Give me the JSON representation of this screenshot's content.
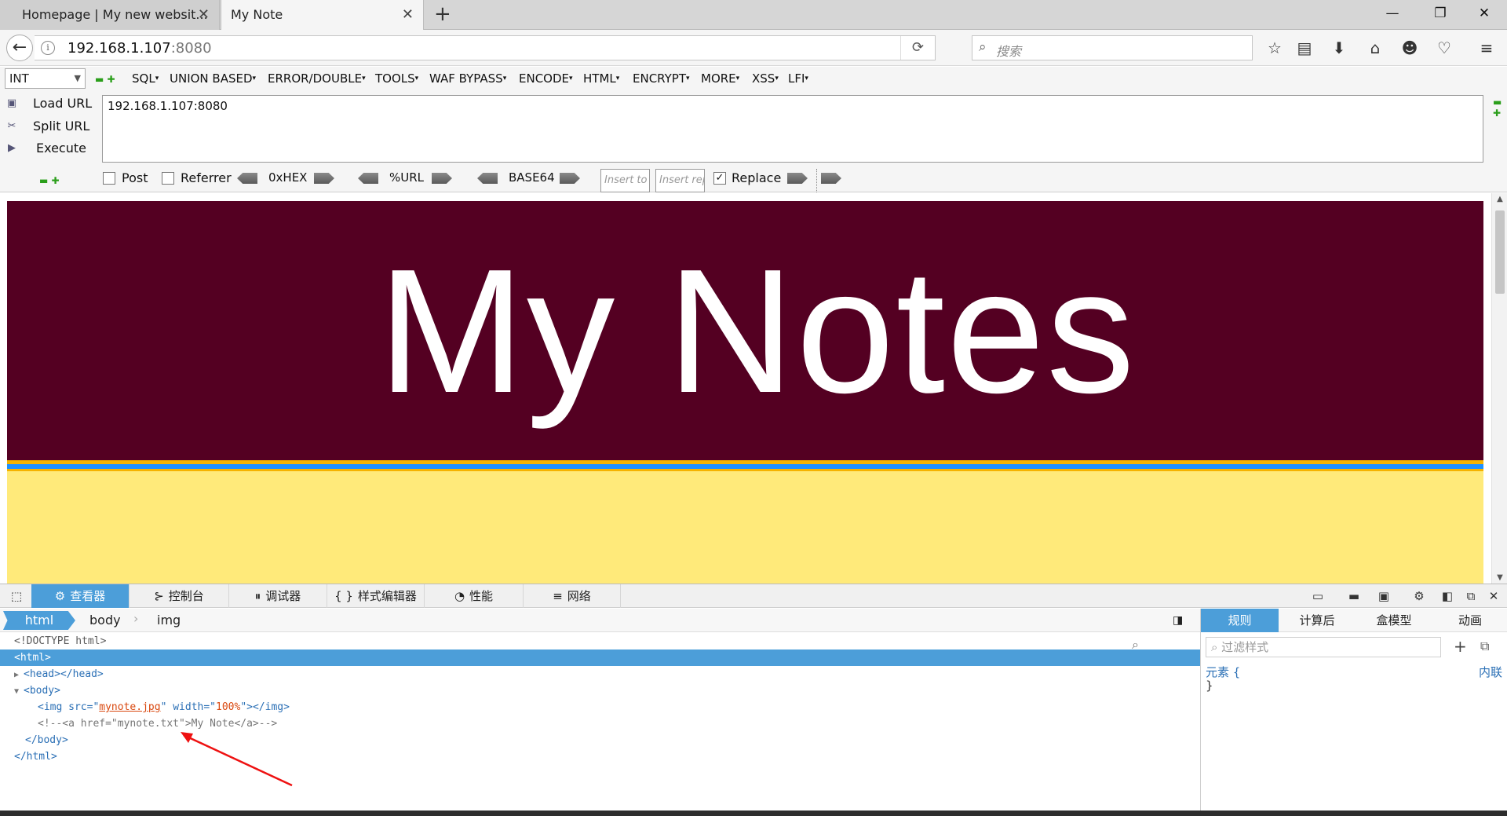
{
  "tabs": [
    {
      "title": "Homepage | My new websit...",
      "close": "✕"
    },
    {
      "title": "My Note",
      "close": "✕"
    }
  ],
  "new_tab": "+",
  "window_controls": {
    "minimize": "—",
    "restore": "❐",
    "close": "✕"
  },
  "nav": {
    "url_host": "192.168.1.107",
    "url_port": ":8080",
    "search_placeholder": "搜索",
    "icons": [
      "back-arrow-icon",
      "info-icon",
      "reload-icon",
      "search-icon",
      "star-icon",
      "reading-list-icon",
      "download-icon",
      "home-icon",
      "chat-icon",
      "pocket-icon",
      "menu-icon"
    ]
  },
  "hackbar": {
    "select_value": "INT",
    "menus": [
      "SQL",
      "UNION BASED",
      "ERROR/DOUBLE",
      "TOOLS",
      "WAF BYPASS",
      "ENCODE",
      "HTML",
      "ENCRYPT",
      "MORE",
      "XSS",
      "LFI"
    ],
    "actions": {
      "load": "Load URL",
      "split": "Split URL",
      "execute": "Execute"
    },
    "url_value": "192.168.1.107:8080",
    "options": {
      "post": "Post",
      "referrer": "Referrer",
      "hex": "0xHEX",
      "url": "%URL",
      "base64": "BASE64",
      "insert1": "Insert to r",
      "insert2": "Insert rep",
      "replace": "Replace"
    }
  },
  "page": {
    "banner_title": "My Notes",
    "colors": {
      "banner": "#540022",
      "stripe_gold": "#f5b300",
      "stripe_blue": "#1e90ff",
      "yellow": "#ffea7a"
    }
  },
  "devtools": {
    "tabs": [
      "查看器",
      "控制台",
      "调试器",
      "样式编辑器",
      "性能",
      "网络"
    ],
    "breadcrumbs": [
      "html",
      "body",
      "img"
    ],
    "markup": {
      "doctype": "<!DOCTYPE html>",
      "html_open": "<html>",
      "head": "<head></head>",
      "body_open": "<body>",
      "img_tag_start": "<img src=\"",
      "img_src": "mynote.jpg",
      "img_width_attr": "\" width=\"",
      "img_width": "100%",
      "img_tag_end": "\"></img>",
      "comment": "<!--<a href=\"mynote.txt\">My Note</a>-->",
      "body_close": "</body>",
      "html_close": "</html>"
    },
    "side_tabs": [
      "规则",
      "计算后",
      "盒模型",
      "动画"
    ],
    "filter_placeholder": "过滤样式",
    "rule_selector": "元素 {",
    "rule_close": "}",
    "rule_source": "内联"
  }
}
